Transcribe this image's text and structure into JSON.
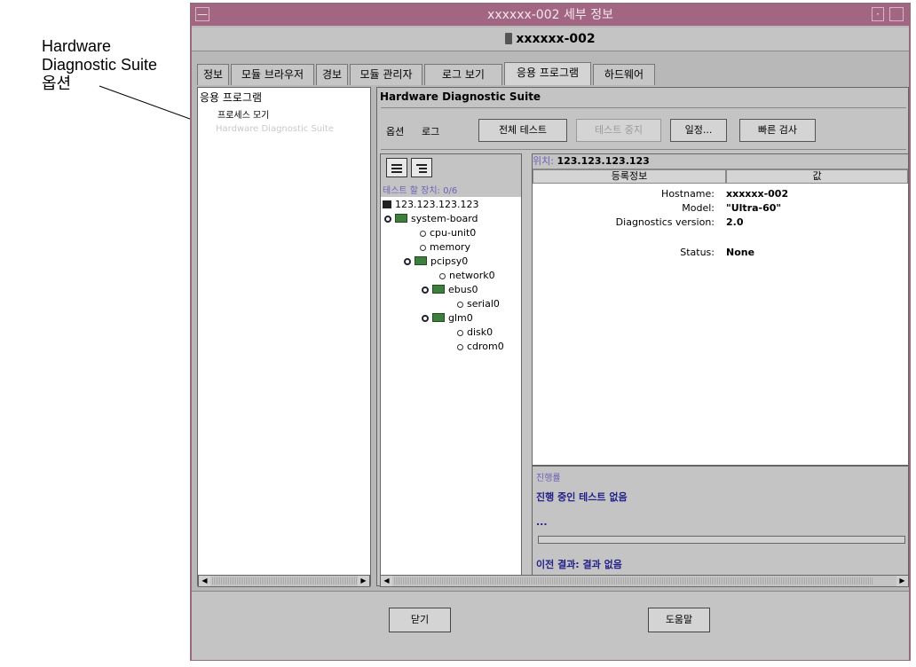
{
  "callout": {
    "line1": "Hardware",
    "line2": "Diagnostic Suite",
    "line3": "옵션"
  },
  "window": {
    "title": "xxxxxx-002 세부 정보",
    "host": "xxxxxx-002"
  },
  "tabs": [
    "정보",
    "모듈 브라우저",
    "경보",
    "모듈 관리자",
    "로그 보기",
    "응용 프로그램",
    "하드웨어"
  ],
  "active_tab": "응용 프로그램",
  "left_tree": {
    "root": "응용 프로그램",
    "child1": "프로세스 모기",
    "child2": "Hardware Diagnostic Suite"
  },
  "hds": {
    "title": "Hardware Diagnostic Suite",
    "menu_options": "옵션",
    "menu_log": "로그",
    "btn_all_test": "전체 테스트",
    "btn_stop_test": "테스트 중지",
    "btn_schedule": "일정...",
    "btn_quick_check": "빠른 검사"
  },
  "device_tree": {
    "count_label": "테스트 할 장치: 0/6",
    "nodes": [
      "123.123.123.123",
      "system-board",
      "cpu-unit0",
      "memory",
      "pcipsy0",
      "network0",
      "ebus0",
      "serial0",
      "glm0",
      "disk0",
      "cdrom0"
    ]
  },
  "info": {
    "location_label": "위치:",
    "location_value": "123.123.123.123",
    "col_props": "등록정보",
    "col_value": "값",
    "rows": [
      {
        "key": "Hostname:",
        "value": "xxxxxx-002"
      },
      {
        "key": "Model:",
        "value": "\"Ultra-60\""
      },
      {
        "key": "Diagnostics version:",
        "value": "2.0"
      },
      {
        "key": "Status:",
        "value": "None"
      }
    ]
  },
  "progress": {
    "label": "진행률",
    "status": "진행 중인 테스트 없음",
    "dots": "...",
    "previous": "이전 결과: 결과 없음"
  },
  "footer": {
    "close": "닫기",
    "help": "도움말"
  },
  "colors": {
    "titlebar": "#a26582",
    "window_bg": "#c4c4c4",
    "accent_text": "#6a62b7"
  }
}
